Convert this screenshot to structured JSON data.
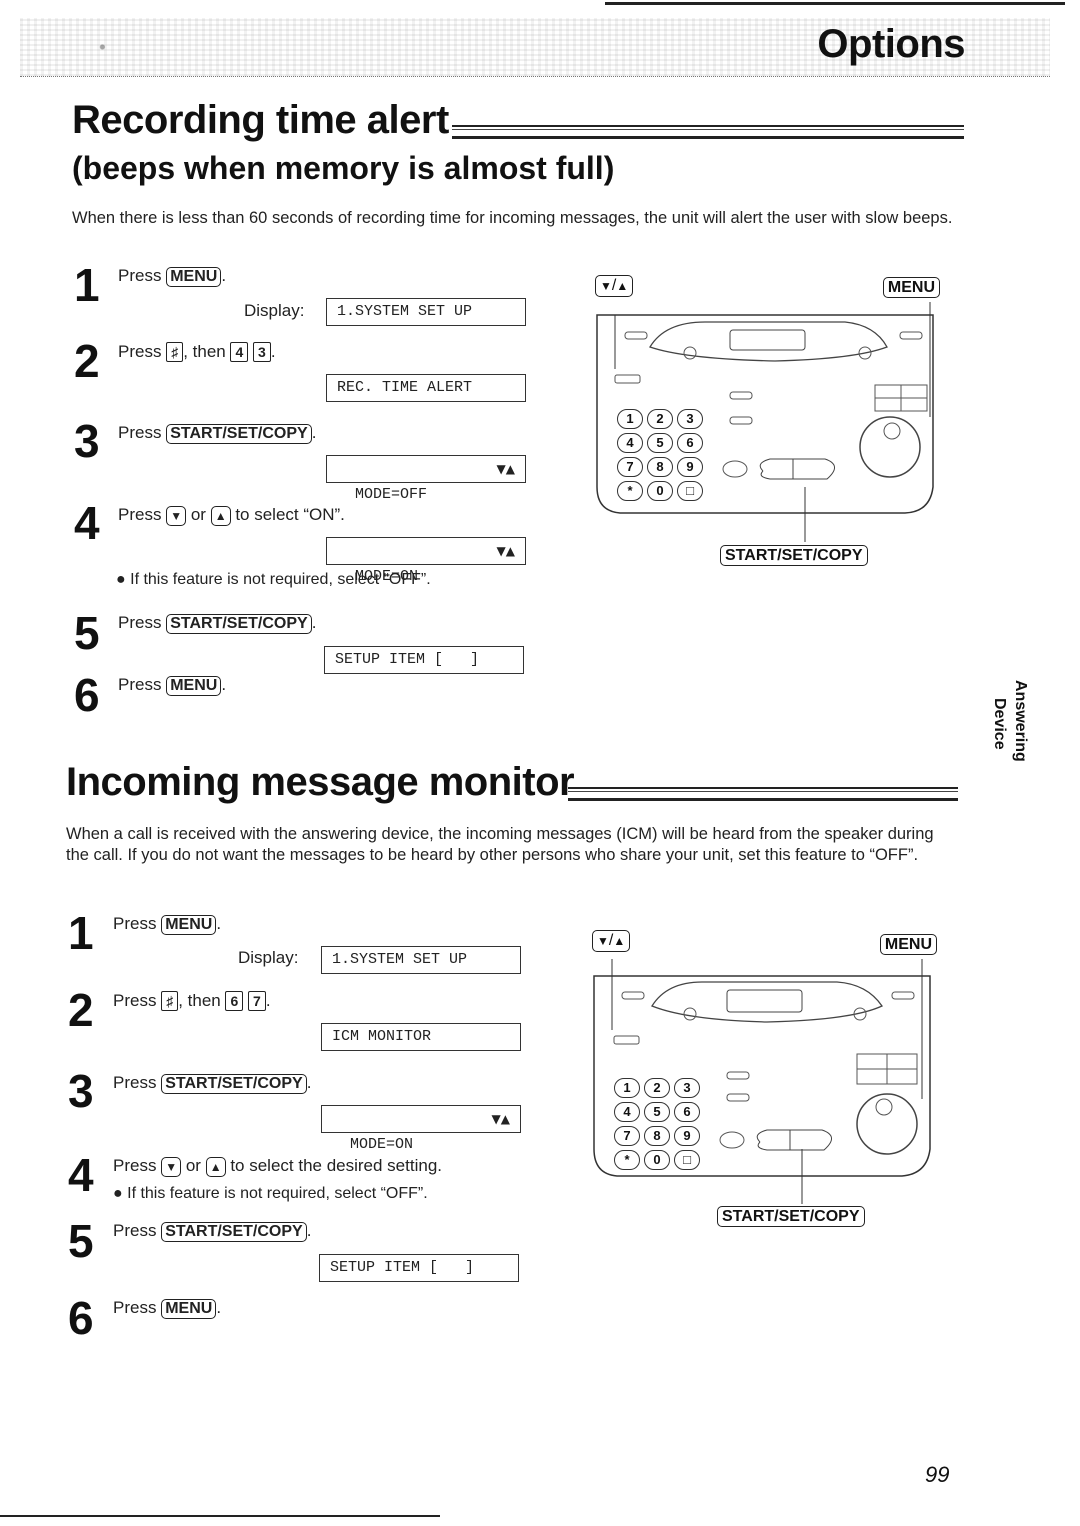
{
  "header": {
    "title": "Options"
  },
  "side_tab": {
    "line1": "Answering",
    "line2": "Device"
  },
  "page_number": "99",
  "common": {
    "display_label": "Display:",
    "press": "Press",
    "key_menu": "MENU",
    "key_start": "START/SET/COPY",
    "key_hash": "♯",
    "key_down": "▼",
    "key_up": "▲",
    "then": ", then",
    "or": "or",
    "period": ".",
    "lcd_arrows": "▼▲",
    "device_label_updown_sep": "/"
  },
  "sections": [
    {
      "title": "Recording time alert",
      "subtitle": "(beeps when memory is almost full)",
      "intro": "When there is less than 60 seconds of recording time for incoming messages, the unit will alert the user with slow beeps.",
      "steps": [
        {
          "num": "1",
          "lcd": "1.SYSTEM SET UP"
        },
        {
          "num": "2",
          "digits": [
            "4",
            "3"
          ],
          "lcd": "REC. TIME ALERT"
        },
        {
          "num": "3",
          "lcd": "MODE=OFF"
        },
        {
          "num": "4",
          "suffix": "to select “ON”.",
          "lcd": "MODE=ON",
          "note": "If this feature is not required, select “OFF”."
        },
        {
          "num": "5",
          "lcd": "SETUP ITEM [   ]"
        },
        {
          "num": "6"
        }
      ]
    },
    {
      "title": "Incoming message monitor",
      "intro": "When a call is received with the answering device, the incoming messages (ICM) will be heard from the speaker during the call. If you do not want the messages to be heard by other persons who share your unit, set this feature to “OFF”.",
      "steps": [
        {
          "num": "1",
          "lcd": "1.SYSTEM SET UP"
        },
        {
          "num": "2",
          "digits": [
            "6",
            "7"
          ],
          "lcd": "ICM MONITOR"
        },
        {
          "num": "3",
          "lcd": "MODE=ON"
        },
        {
          "num": "4",
          "suffix": "to select the desired setting.",
          "note": "If this feature is not required, select “OFF”."
        },
        {
          "num": "5",
          "lcd": "SETUP ITEM [   ]"
        },
        {
          "num": "6"
        }
      ]
    }
  ],
  "device": {
    "keypad": [
      "1",
      "2",
      "3",
      "4",
      "5",
      "6",
      "7",
      "8",
      "9",
      "*",
      "0",
      "□"
    ]
  }
}
